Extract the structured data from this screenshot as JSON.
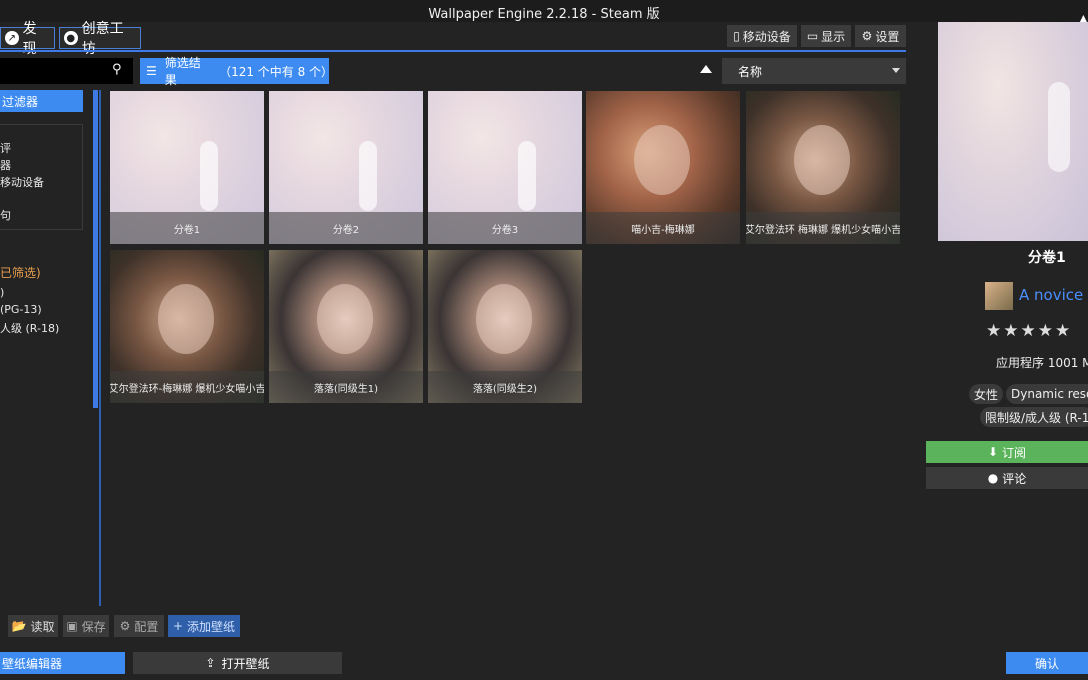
{
  "window": {
    "title": "Wallpaper Engine 2.2.18 - Steam 版"
  },
  "nav": {
    "discover": "发现",
    "workshop": "创意工坊"
  },
  "top_buttons": {
    "mobile": "移动设备",
    "display": "显示",
    "settings": "设置"
  },
  "filter": {
    "label": "筛选结果",
    "count": "（121 个中有 8 个）"
  },
  "sort": {
    "selected": "名称"
  },
  "sidebar": {
    "header": "过滤器",
    "type_items": [
      "评",
      "器",
      "移动设备",
      "句"
    ],
    "age_title": "已筛选)",
    "age_items": [
      ")",
      "(PG-13)",
      "人级 (R-18)"
    ]
  },
  "wallpapers": [
    {
      "title": "分卷1",
      "style": "pastel"
    },
    {
      "title": "分卷2",
      "style": "pastel"
    },
    {
      "title": "分卷3",
      "style": "pastel"
    },
    {
      "title": "喵小吉-梅琳娜",
      "style": "portrait-a"
    },
    {
      "title": "艾尔登法环 梅琳娜 爆机少女喵小吉",
      "style": "portrait-b"
    },
    {
      "title": "艾尔登法环-梅琳娜 爆机少女喵小吉",
      "style": "portrait-b"
    },
    {
      "title": "落落(同级生1)",
      "style": "portrait-c"
    },
    {
      "title": "落落(同级生2)",
      "style": "portrait-c"
    }
  ],
  "bottom_buttons": {
    "load": "读取",
    "save": "保存",
    "config": "配置",
    "add": "添加壁纸"
  },
  "footer": {
    "editor": "壁纸编辑器",
    "open": "打开壁纸",
    "ok": "确认"
  },
  "details": {
    "title": "分卷1",
    "author": "A novice",
    "rating_stars": "★★★★★",
    "app_info": "应用程序 1001 M",
    "tags": [
      "女性",
      "Dynamic reso",
      "限制级/成人级 (R-1"
    ],
    "subscribe": "订阅",
    "comment": "评论"
  },
  "colors": {
    "accent": "#3d8bf0",
    "subscribe": "#5bb35b",
    "background": "#232323"
  }
}
